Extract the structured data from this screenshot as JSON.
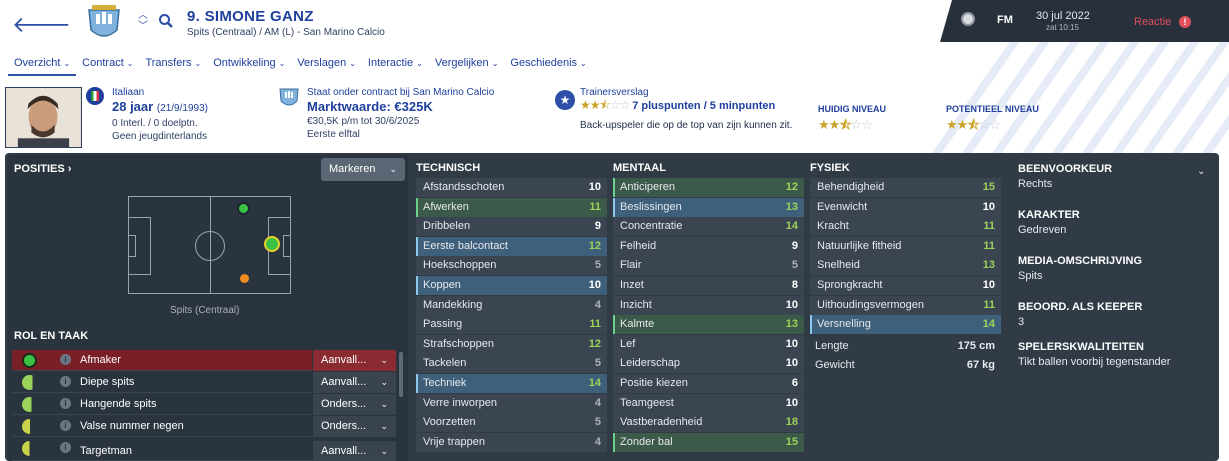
{
  "header": {
    "player_name": "9. SIMONE GANZ",
    "player_sub": "Spits (Centraal) / AM (L) - San Marino Calcio",
    "app": "FM",
    "date": "30 jul 2022",
    "time": "zat 10:15",
    "reactie": "Reactie",
    "reactie_badge": "!"
  },
  "tabs": [
    {
      "label": "Overzicht"
    },
    {
      "label": "Contract"
    },
    {
      "label": "Transfers"
    },
    {
      "label": "Ontwikkeling"
    },
    {
      "label": "Verslagen"
    },
    {
      "label": "Interactie"
    },
    {
      "label": "Vergelijken"
    },
    {
      "label": "Geschiedenis"
    }
  ],
  "info": {
    "nationality": "Italiaan",
    "age": "28 jaar",
    "dob": "(21/9/1993)",
    "caps": "0 Interl. / 0 doelptn.",
    "youth": "Geen jeugdinterlands",
    "contract": "Staat onder contract bij San Marino Calcio",
    "value": "Marktwaarde: €325K",
    "wage": "€30,5K p/m tot 30/6/2025",
    "squad": "Eerste elftal",
    "report_title": "Trainersverslag",
    "report_points": "7 pluspunten / 5 minpunten",
    "report_desc": "Back-upspeler die op de top van zijn kunnen zit.",
    "current_level_label": "HUIDIG NIVEAU",
    "potential_level_label": "POTENTIEEL NIVEAU",
    "report_stars": 2.5,
    "current_stars": 2.5,
    "potential_stars": 2.5
  },
  "positions": {
    "title": "POSITIES ›",
    "markeren": "Markeren",
    "pitch_label": "Spits (Centraal)"
  },
  "roles": {
    "title": "ROL EN TAAK",
    "items": [
      {
        "name": "Afmaker",
        "duty": "Aanvall..."
      },
      {
        "name": "Diepe spits",
        "duty": "Aanvall..."
      },
      {
        "name": "Hangende spits",
        "duty": "Onders..."
      },
      {
        "name": "Valse nummer negen",
        "duty": "Onders..."
      },
      {
        "name": "Targetman",
        "duty": "Aanvall..."
      }
    ]
  },
  "technisch": {
    "title": "TECHNISCH",
    "items": [
      {
        "name": "Afstandsschoten",
        "value": "10"
      },
      {
        "name": "Afwerken",
        "value": "11"
      },
      {
        "name": "Dribbelen",
        "value": "9"
      },
      {
        "name": "Eerste balcontact",
        "value": "12"
      },
      {
        "name": "Hoekschoppen",
        "value": "5"
      },
      {
        "name": "Koppen",
        "value": "10"
      },
      {
        "name": "Mandekking",
        "value": "4"
      },
      {
        "name": "Passing",
        "value": "11"
      },
      {
        "name": "Strafschoppen",
        "value": "12"
      },
      {
        "name": "Tackelen",
        "value": "5"
      },
      {
        "name": "Techniek",
        "value": "14"
      },
      {
        "name": "Verre inworpen",
        "value": "4"
      },
      {
        "name": "Voorzetten",
        "value": "5"
      },
      {
        "name": "Vrije trappen",
        "value": "4"
      }
    ]
  },
  "mentaal": {
    "title": "MENTAAL",
    "items": [
      {
        "name": "Anticiperen",
        "value": "12"
      },
      {
        "name": "Beslissingen",
        "value": "13"
      },
      {
        "name": "Concentratie",
        "value": "14"
      },
      {
        "name": "Felheid",
        "value": "9"
      },
      {
        "name": "Flair",
        "value": "5"
      },
      {
        "name": "Inzet",
        "value": "8"
      },
      {
        "name": "Inzicht",
        "value": "10"
      },
      {
        "name": "Kalmte",
        "value": "13"
      },
      {
        "name": "Lef",
        "value": "10"
      },
      {
        "name": "Leiderschap",
        "value": "10"
      },
      {
        "name": "Positie kiezen",
        "value": "6"
      },
      {
        "name": "Teamgeest",
        "value": "10"
      },
      {
        "name": "Vastberadenheid",
        "value": "18"
      },
      {
        "name": "Zonder bal",
        "value": "15"
      }
    ]
  },
  "fysiek": {
    "title": "FYSIEK",
    "items": [
      {
        "name": "Behendigheid",
        "value": "15"
      },
      {
        "name": "Evenwicht",
        "value": "10"
      },
      {
        "name": "Kracht",
        "value": "11"
      },
      {
        "name": "Natuurlijke fitheid",
        "value": "11"
      },
      {
        "name": "Snelheid",
        "value": "13"
      },
      {
        "name": "Sprongkracht",
        "value": "10"
      },
      {
        "name": "Uithoudingsvermogen",
        "value": "11"
      },
      {
        "name": "Versnelling",
        "value": "14"
      }
    ],
    "length_label": "Lengte",
    "length_value": "175 cm",
    "weight_label": "Gewicht",
    "weight_value": "67 kg"
  },
  "details": {
    "foot_title": "BEENVOORKEUR",
    "foot_value": "Rechts",
    "char_title": "KARAKTER",
    "char_value": "Gedreven",
    "media_title": "MEDIA-OMSCHRIJVING",
    "media_value": "Spits",
    "keeper_title": "BEOORD. ALS KEEPER",
    "keeper_value": "3",
    "traits_title": "SPELERSKWALITEITEN",
    "traits_value": "Tikt ballen voorbij tegenstander"
  },
  "colors": {
    "brand": "#1f3f9c",
    "panel": "#303b46",
    "high": "#9bd35a",
    "mid": "#ffffff",
    "low": "#a9b2bc"
  }
}
